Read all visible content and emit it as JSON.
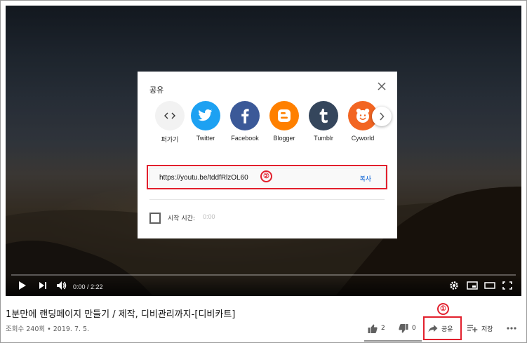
{
  "player": {
    "time_display": "0:00 / 2:22",
    "icons": [
      "play-icon",
      "next-icon",
      "volume-icon",
      "settings-icon",
      "miniplayer-icon",
      "theater-icon",
      "fullscreen-icon"
    ]
  },
  "share_dialog": {
    "title": "공유",
    "targets": [
      {
        "label": "퍼가기",
        "icon": "embed-icon",
        "color": "#f2f2f2"
      },
      {
        "label": "Twitter",
        "icon": "twitter-icon",
        "color": "#1da1f2"
      },
      {
        "label": "Facebook",
        "icon": "facebook-icon",
        "color": "#3b5998"
      },
      {
        "label": "Blogger",
        "icon": "blogger-icon",
        "color": "#ff8000"
      },
      {
        "label": "Tumblr",
        "icon": "tumblr-icon",
        "color": "#35465c"
      },
      {
        "label": "Cyworld",
        "icon": "cyworld-icon",
        "color": "#f26522"
      }
    ],
    "url": "https://youtu.be/tddfRlzOL60",
    "copy_label": "복사",
    "start_at_label": "시작 시간:",
    "start_at_value": "0:00"
  },
  "annotations": {
    "badge1": "①",
    "badge2": "②",
    "highlight_color": "#e2202d"
  },
  "video": {
    "title": "1분만에 랜딩페이지 만들기 / 제작, 디비관리까지-[디비카트]",
    "meta": "조회수 240회 • 2019. 7. 5.",
    "actions": {
      "like_count": "2",
      "dislike_count": "0",
      "share_label": "공유",
      "save_label": "저장"
    }
  }
}
